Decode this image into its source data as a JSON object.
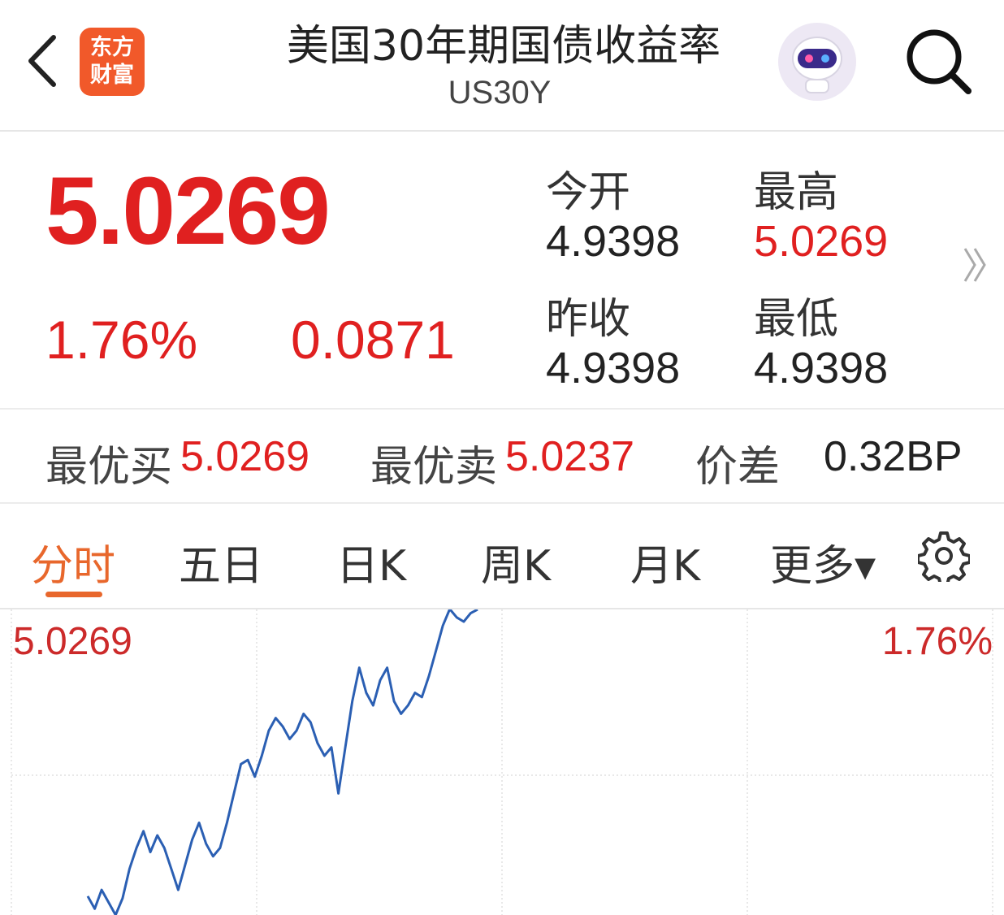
{
  "header": {
    "logo_line1": "东方",
    "logo_line2": "财富",
    "title": "美国30年期国债收益率",
    "subtitle": "US30Y",
    "icons": {
      "back": "back-chevron-icon",
      "search": "search-icon",
      "avatar": "robot-assistant-avatar"
    }
  },
  "quote": {
    "price": "5.0269",
    "change_pct": "1.76%",
    "change_abs": "0.0871",
    "stats": {
      "open_label": "今开",
      "open_value": "4.9398",
      "high_label": "最高",
      "high_value": "5.0269",
      "prev_close_label": "昨收",
      "prev_close_value": "4.9398",
      "low_label": "最低",
      "low_value": "4.9398"
    },
    "more_icon": "double-chevron-right-icon"
  },
  "order_book": {
    "best_bid_label": "最优买",
    "best_bid_value": "5.0269",
    "best_ask_label": "最优卖",
    "best_ask_value": "5.0237",
    "spread_label": "价差",
    "spread_value": "0.32BP"
  },
  "tabs": {
    "items": [
      "分时",
      "五日",
      "日K",
      "周K",
      "月K",
      "更多▾"
    ],
    "active_index": 0,
    "settings_icon": "gear-icon"
  },
  "colors": {
    "up": "#e02020",
    "accent": "#e8672c",
    "line": "#2b5fb3"
  },
  "chart_data": {
    "type": "line",
    "left_axis_top_label": "5.0269",
    "right_axis_top_label": "1.76%",
    "series": [
      {
        "values": [
          4.9585,
          4.9555,
          4.96,
          4.957,
          4.954,
          4.958,
          4.965,
          4.97,
          4.974,
          4.969,
          4.973,
          4.97,
          4.965,
          4.96,
          4.966,
          4.972,
          4.976,
          4.971,
          4.968,
          4.97,
          4.976,
          4.983,
          4.99,
          4.991,
          4.987,
          4.992,
          4.998,
          5.001,
          4.999,
          4.996,
          4.998,
          5.002,
          5.0,
          4.995,
          4.992,
          4.994,
          4.983,
          4.994,
          5.005,
          5.013,
          5.007,
          5.004,
          5.01,
          5.013,
          5.005,
          5.002,
          5.004,
          5.007,
          5.006,
          5.011,
          5.017,
          5.023,
          5.027,
          5.025,
          5.024,
          5.026,
          5.0269
        ]
      }
    ]
  }
}
